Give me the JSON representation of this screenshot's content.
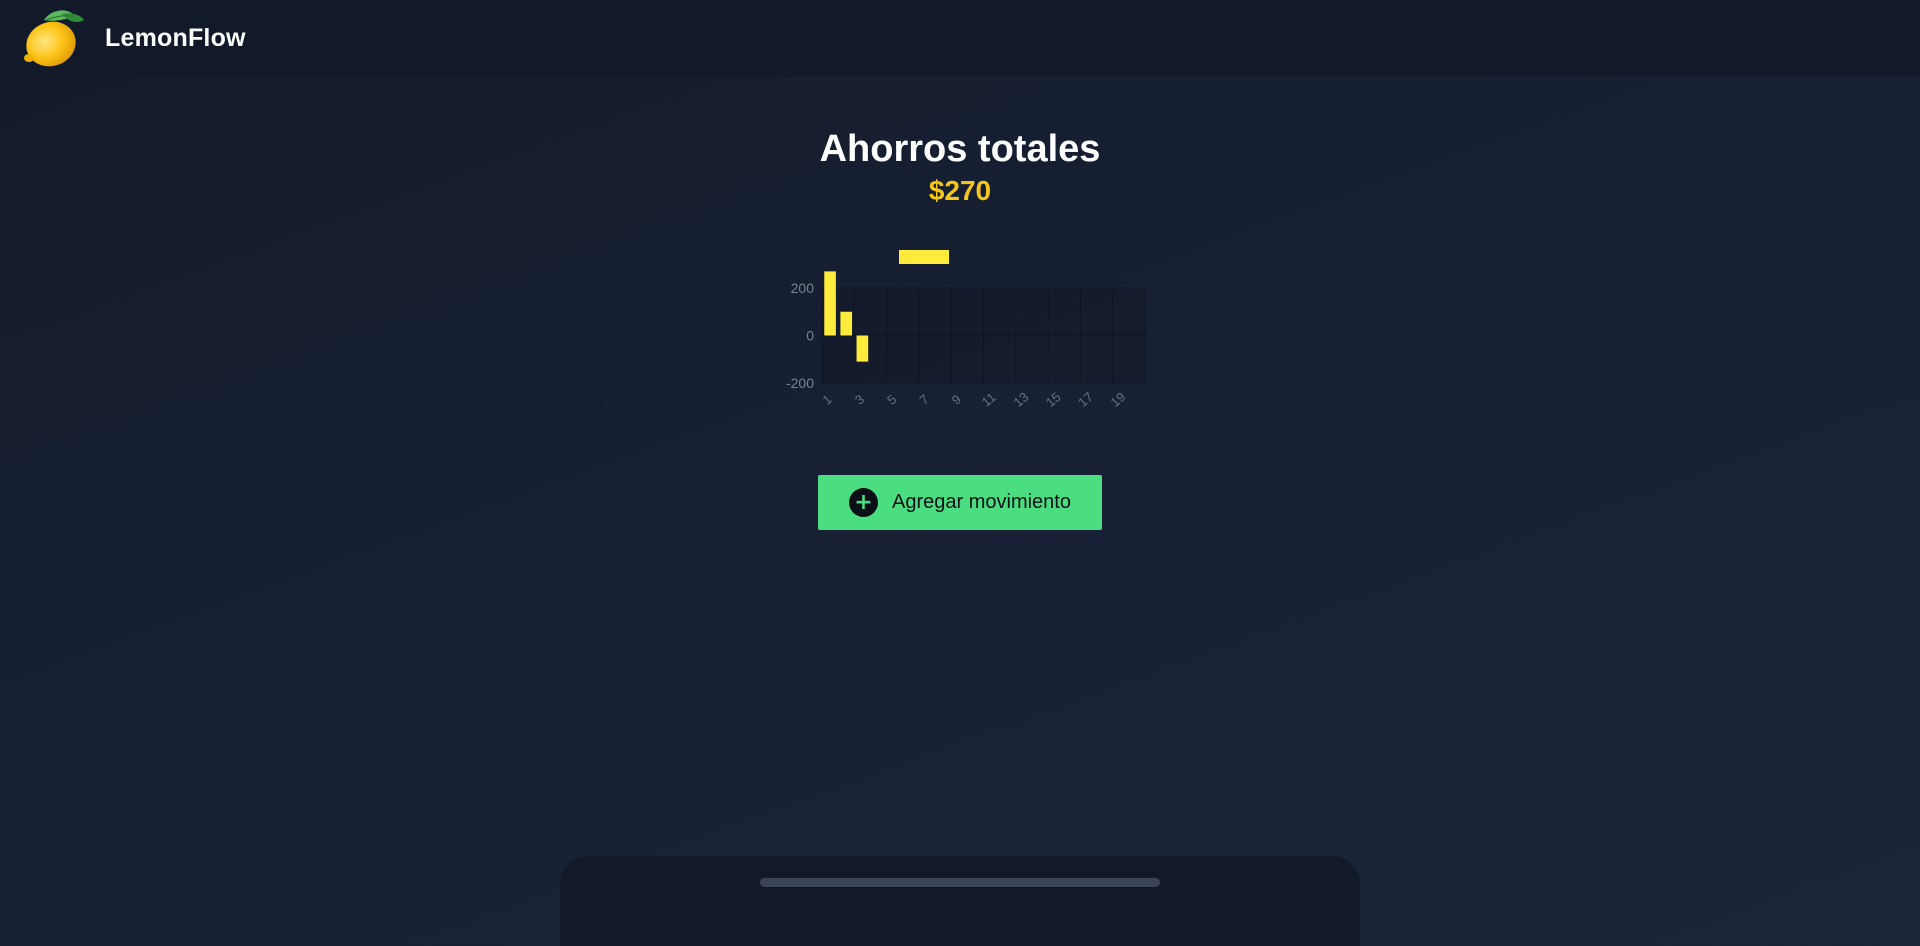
{
  "header": {
    "app_name": "LemonFlow",
    "logo_icon": "lemon-icon"
  },
  "summary": {
    "title": "Ahorros totales",
    "amount": "$270"
  },
  "chart_data": {
    "type": "bar",
    "x": [
      1,
      2,
      3,
      4,
      5,
      6,
      7,
      8,
      9,
      10,
      11,
      12,
      13,
      14,
      15,
      16,
      17,
      18,
      19,
      20
    ],
    "x_tick_labels": [
      "1",
      "3",
      "5",
      "7",
      "9",
      "11",
      "13",
      "15",
      "17",
      "19"
    ],
    "values": [
      270,
      100,
      -110,
      null,
      null,
      null,
      null,
      null,
      null,
      null,
      null,
      null,
      null,
      null,
      null,
      null,
      null,
      null,
      null,
      null
    ],
    "y_tick_labels": [
      "200",
      "0",
      "-200"
    ],
    "ylim": [
      -200,
      200
    ],
    "legend": [
      {
        "label": "",
        "color": "#ffeb3b"
      }
    ],
    "bar_color": "#ffeb3b",
    "grid": true
  },
  "actions": {
    "add_label": "Agregar movimiento",
    "add_icon": "plus-circle-icon",
    "accent_color": "#4ade80"
  },
  "colors": {
    "amount": "#f5c518",
    "bars": "#ffeb3b"
  }
}
